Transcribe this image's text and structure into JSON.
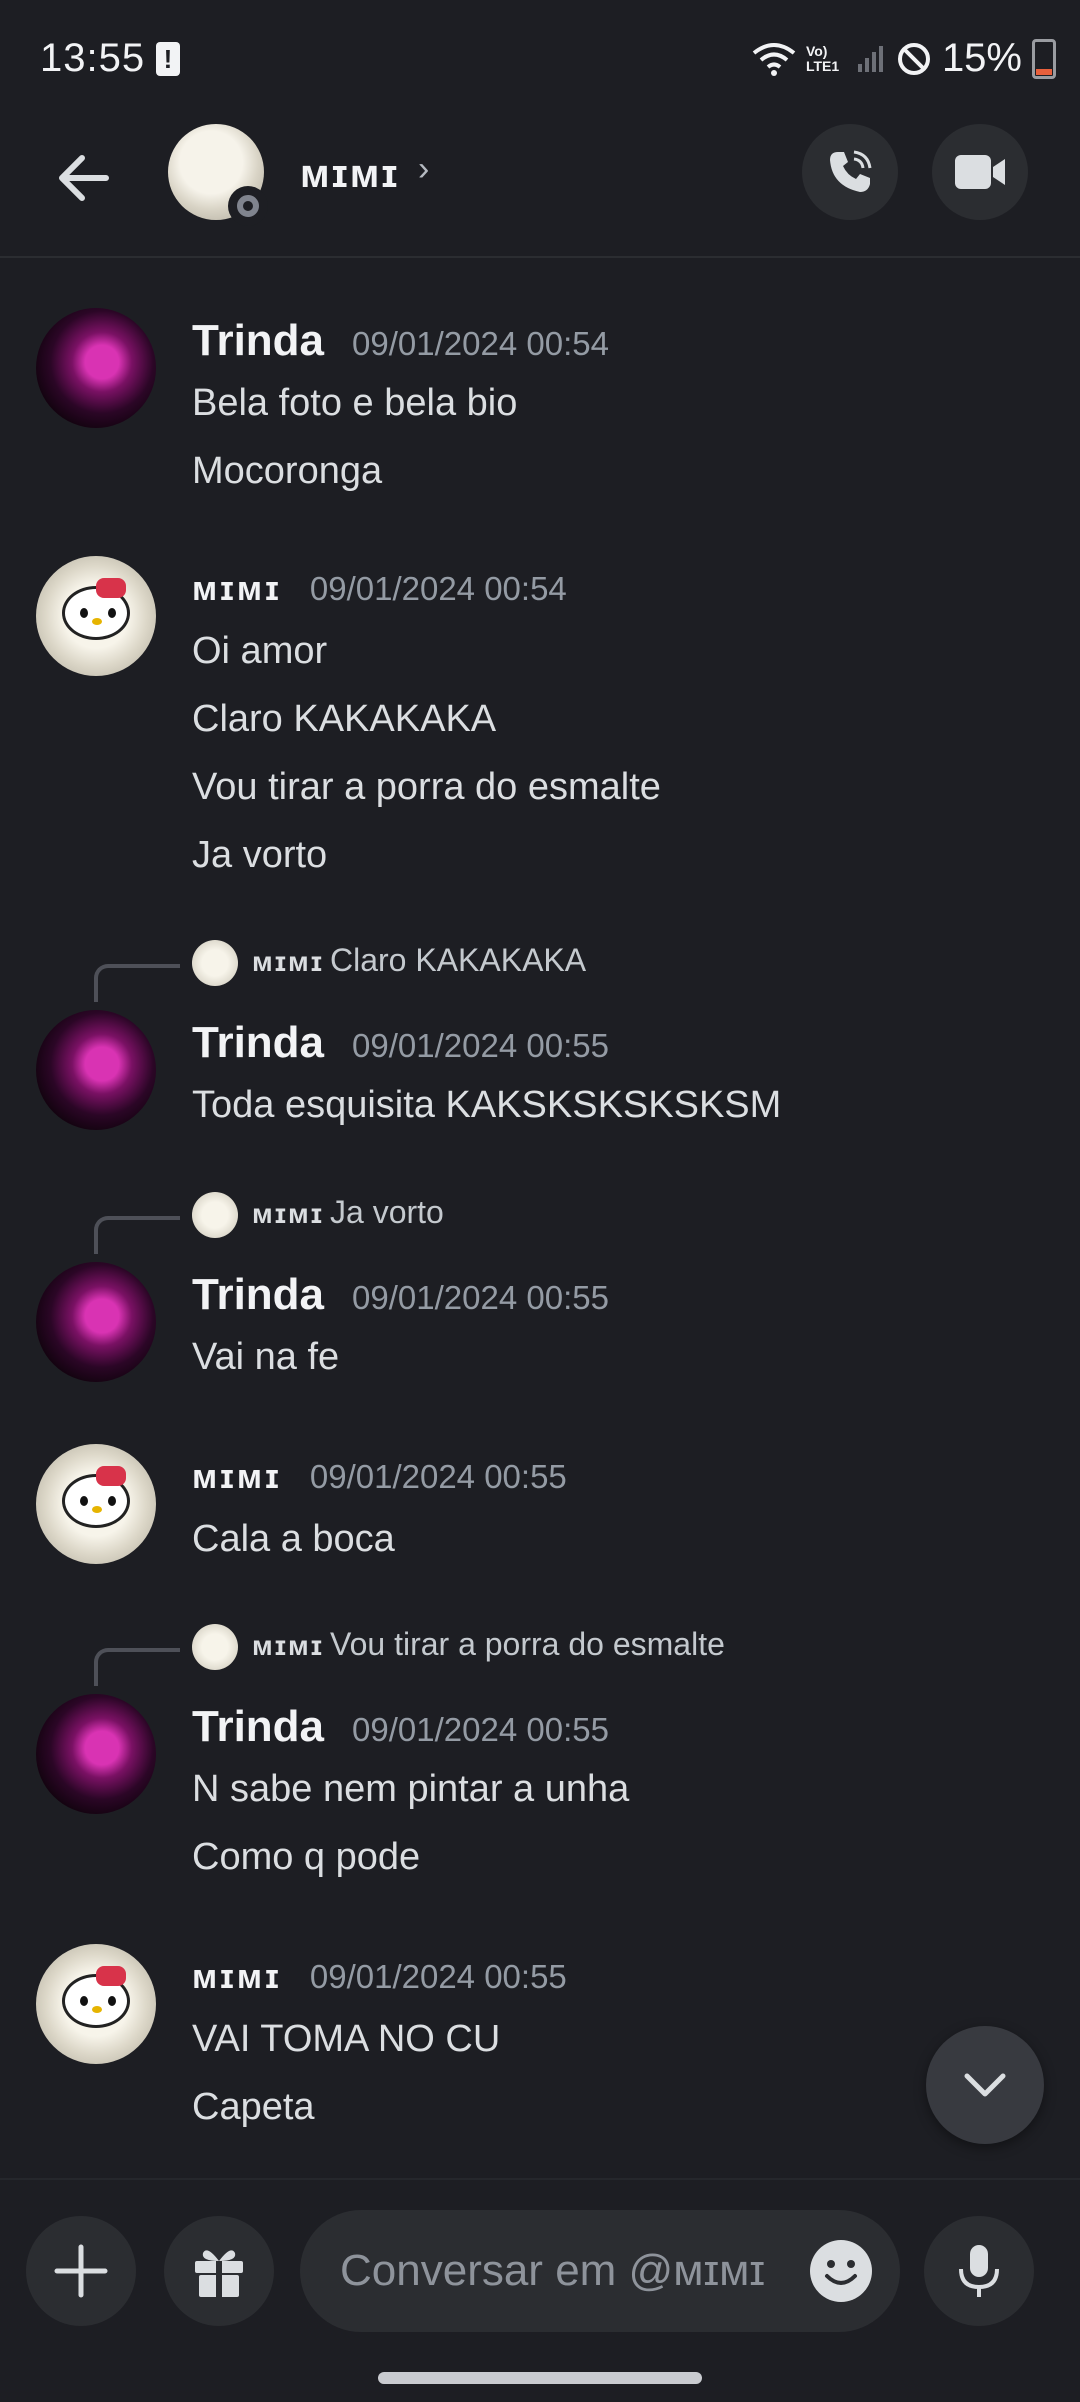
{
  "status_bar": {
    "time": "13:55",
    "battery": "15%",
    "network_label": "Vo) LTE1"
  },
  "header": {
    "contact_name": "ᴍɪᴍɪ",
    "chevron": "›"
  },
  "messages": [
    {
      "author": "Trinda",
      "timestamp": "09/01/2024 00:54",
      "lines": [
        "Bela foto e bela bio",
        "Mocoronga"
      ]
    },
    {
      "author": "ᴍɪᴍɪ",
      "timestamp": "09/01/2024 00:54",
      "lines": [
        "Oi amor",
        "Claro KAKAKAKA",
        "Vou tirar a porra do esmalte",
        "Ja vorto"
      ]
    },
    {
      "reply_author": "ᴍɪᴍɪ",
      "reply_text": "Claro KAKAKAKA",
      "author": "Trinda",
      "timestamp": "09/01/2024 00:55",
      "lines": [
        "Toda esquisita KAKSKSKSKSKSM"
      ]
    },
    {
      "reply_author": "ᴍɪᴍɪ",
      "reply_text": "Ja vorto",
      "author": "Trinda",
      "timestamp": "09/01/2024 00:55",
      "lines": [
        "Vai na fe"
      ]
    },
    {
      "author": "ᴍɪᴍɪ",
      "timestamp": "09/01/2024 00:55",
      "lines": [
        "Cala a boca"
      ]
    },
    {
      "reply_author": "ᴍɪᴍɪ",
      "reply_text": "Vou tirar a porra do esmalte",
      "author": "Trinda",
      "timestamp": "09/01/2024 00:55",
      "lines": [
        "N sabe nem pintar a unha",
        "Como q pode"
      ]
    },
    {
      "author": "ᴍɪᴍɪ",
      "timestamp": "09/01/2024 00:55",
      "lines": [
        "VAI TOMA NO CU",
        "Capeta"
      ]
    }
  ],
  "composer": {
    "placeholder": "Conversar em @ᴍɪᴍɪ"
  },
  "icons": {
    "back": "arrow-left-icon",
    "call": "phone-call-icon",
    "video": "video-camera-icon",
    "plus": "plus-icon",
    "gift": "gift-icon",
    "emoji": "smiley-icon",
    "mic": "microphone-icon",
    "scroll": "chevron-down-icon"
  },
  "colors": {
    "background": "#1d1e23",
    "button_bg": "#2b2d31",
    "timestamp": "#949ba4",
    "text": "#dbdee1"
  }
}
